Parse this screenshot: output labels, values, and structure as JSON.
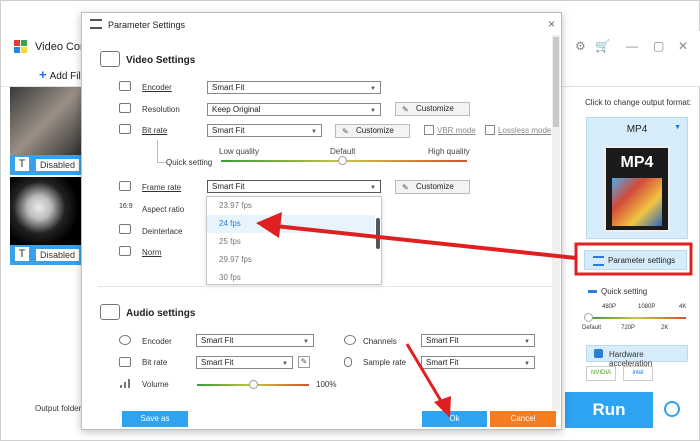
{
  "app": {
    "title": "Video Conve",
    "add_files": "Add Files",
    "clips": [
      {
        "subtitle_label": "Disabled"
      },
      {
        "subtitle_label": "Disabled"
      }
    ],
    "output_folder_label": "Output folder:",
    "run_label": "Run"
  },
  "right_panel": {
    "hint": "Click to change output format:",
    "format": "MP4",
    "format_icon_text": "MP4",
    "parameter_settings": "Parameter settings",
    "quick_setting": "Quick setting",
    "quick_ticks_top": [
      "480P",
      "1080P",
      "4K"
    ],
    "quick_ticks_bottom": [
      "Default",
      "720P",
      "2K"
    ],
    "hw_accel": "Hardware acceleration",
    "vendors": [
      "NVIDIA",
      "intel"
    ]
  },
  "dialog": {
    "title": "Parameter Settings",
    "close": "×",
    "video": {
      "heading": "Video Settings",
      "encoder_label": "Encoder",
      "encoder_value": "Smart Fit",
      "resolution_label": "Resolution",
      "resolution_value": "Keep Original",
      "customize": "Customize",
      "bitrate_label": "Bit rate",
      "bitrate_value": "Smart Fit",
      "vbr_label": "VBR mode",
      "lossless_label": "Lossless mode",
      "quick_setting_label": "Quick setting",
      "quality_low": "Low quality",
      "quality_default": "Default",
      "quality_high": "High quality",
      "framerate_label": "Frame rate",
      "framerate_value": "Smart Fit",
      "aspect_label": "Aspect ratio",
      "deinterlace_label": "Deinterlace",
      "norm_label": "Norm",
      "fps_options": [
        "23.97 fps",
        "24 fps",
        "25 fps",
        "29.97 fps",
        "30 fps"
      ],
      "fps_highlighted": "24 fps"
    },
    "audio": {
      "heading": "Audio settings",
      "encoder_label": "Encoder",
      "encoder_value": "Smart Fit",
      "bitrate_label": "Bit rate",
      "bitrate_value": "Smart Fit",
      "volume_label": "Volume",
      "volume_value": "100%",
      "channels_label": "Channels",
      "channels_value": "Smart Fit",
      "samplerate_label": "Sample rate",
      "samplerate_value": "Smart Fit"
    },
    "save_as": "Save as",
    "ok": "Ok",
    "cancel": "Cancel"
  },
  "colors": {
    "accent": "#2ea3f2",
    "ok_button": "#2ea3f2",
    "cancel_button": "#f57c1f",
    "annotation_red": "#e02020",
    "highlight_box": "#e02020"
  }
}
